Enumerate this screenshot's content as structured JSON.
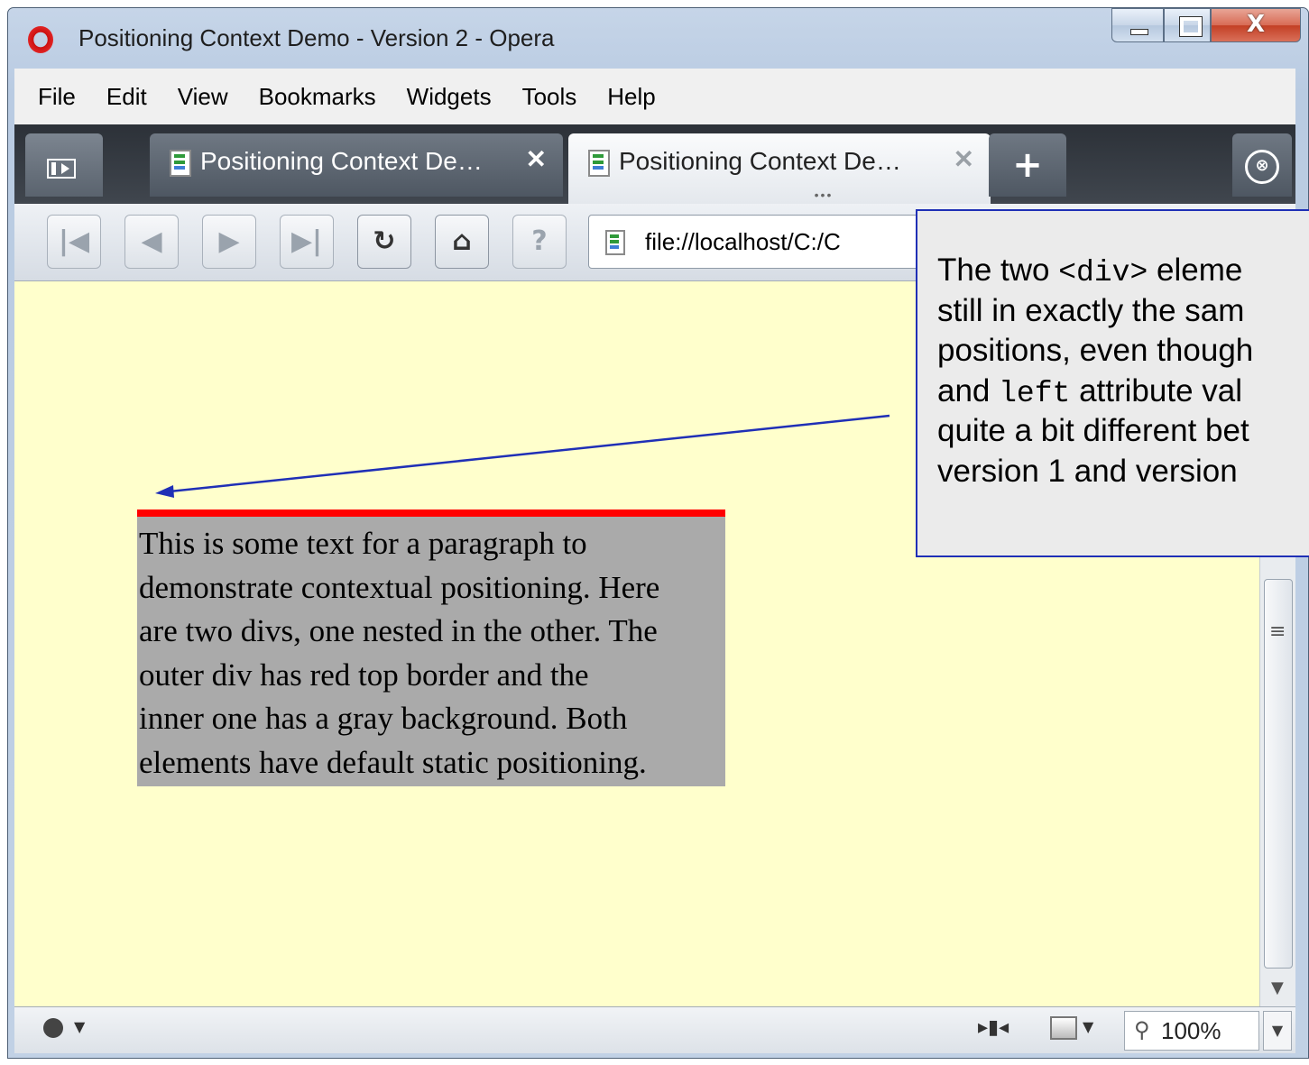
{
  "window": {
    "title": "Positioning Context Demo - Version 2 - Opera",
    "controls": {
      "minimize": "—",
      "maximize": "☐",
      "close": "X"
    }
  },
  "menu": [
    "File",
    "Edit",
    "View",
    "Bookmarks",
    "Widgets",
    "Tools",
    "Help"
  ],
  "tabs": [
    {
      "label": "Positioning Context De…",
      "close": "✕",
      "active": false
    },
    {
      "label": "Positioning Context De…",
      "close": "✕",
      "active": true,
      "dots": "•••"
    }
  ],
  "toolbar": {
    "new_tab": "+",
    "trash": "⊗",
    "buttons": [
      "|◀",
      "◀",
      "▶",
      "▶|",
      "↻",
      "⌂",
      "?"
    ],
    "address": "file://localhost/C:/C"
  },
  "page": {
    "paragraph": "This is some text for a paragraph to demonstrate contextual positioning. Here are two divs, one nested in the other. The outer div has red top border and the inner one has a gray background. Both elements have default static positioning.",
    "paragraph_lines": [
      "This is some text for a paragraph to",
      "demonstrate contextual positioning. Here",
      "are two divs, one nested in the other. The",
      "outer div has red top border and the",
      "inner one has a gray background. Both",
      "elements have default static positioning."
    ],
    "outer_border_color": "#ff0000",
    "inner_bg_color": "#aaaaaa",
    "background": "#ffffcc"
  },
  "callout": {
    "l1a": "The two ",
    "l1code": "<div>",
    "l1b": "  eleme",
    "l2": "still in exactly the sam",
    "l3": "positions, even though",
    "l4a": "and ",
    "l4code": "left",
    "l4b": " attribute val",
    "l5": "quite a bit different bet",
    "l6": "version 1 and version",
    "border_color": "#1f2fb6"
  },
  "status": {
    "zoom": "100%",
    "scroll_grip": "≡"
  }
}
